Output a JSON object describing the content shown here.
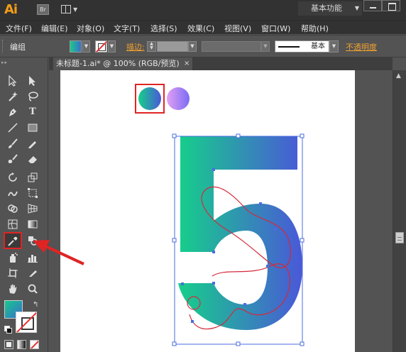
{
  "app": {
    "logo": "Ai",
    "bridge_label": "Br",
    "workspace": "基本功能"
  },
  "menu": [
    "文件(F)",
    "编辑(E)",
    "对象(O)",
    "文字(T)",
    "选择(S)",
    "效果(C)",
    "视图(V)",
    "窗口(W)",
    "帮助(H)"
  ],
  "control": {
    "selection_label": "编组",
    "stroke_label": "描边:",
    "brush_label": "基本",
    "opacity_label": "不透明度"
  },
  "document": {
    "tab_title": "未标题-1.ai* @ 100% (RGB/预览)",
    "close_glyph": "×"
  },
  "colors": {
    "gradient_start": "#16cf8a",
    "gradient_end": "#4a58d8",
    "swatch2_start": "#e29ff2",
    "swatch2_end": "#7b6cf5",
    "highlight": "#e02424",
    "accent_orange": "#f59c1a"
  },
  "canvas": {
    "swatch_count": 2,
    "numeral": "5"
  },
  "tools": [
    "selection-tool",
    "direct-selection-tool",
    "magic-wand-tool",
    "lasso-tool",
    "pen-tool",
    "type-tool",
    "line-segment-tool",
    "rectangle-tool",
    "paintbrush-tool",
    "pencil-tool",
    "blob-brush-tool",
    "eraser-tool",
    "rotate-tool",
    "scale-tool",
    "warp-tool",
    "free-transform-tool",
    "shape-builder-tool",
    "perspective-grid-tool",
    "mesh-tool",
    "gradient-tool",
    "eyedropper-tool",
    "blend-tool",
    "symbol-sprayer-tool",
    "column-graph-tool",
    "artboard-tool",
    "slice-tool",
    "hand-tool",
    "zoom-tool"
  ],
  "selected_tool": "eyedropper-tool"
}
